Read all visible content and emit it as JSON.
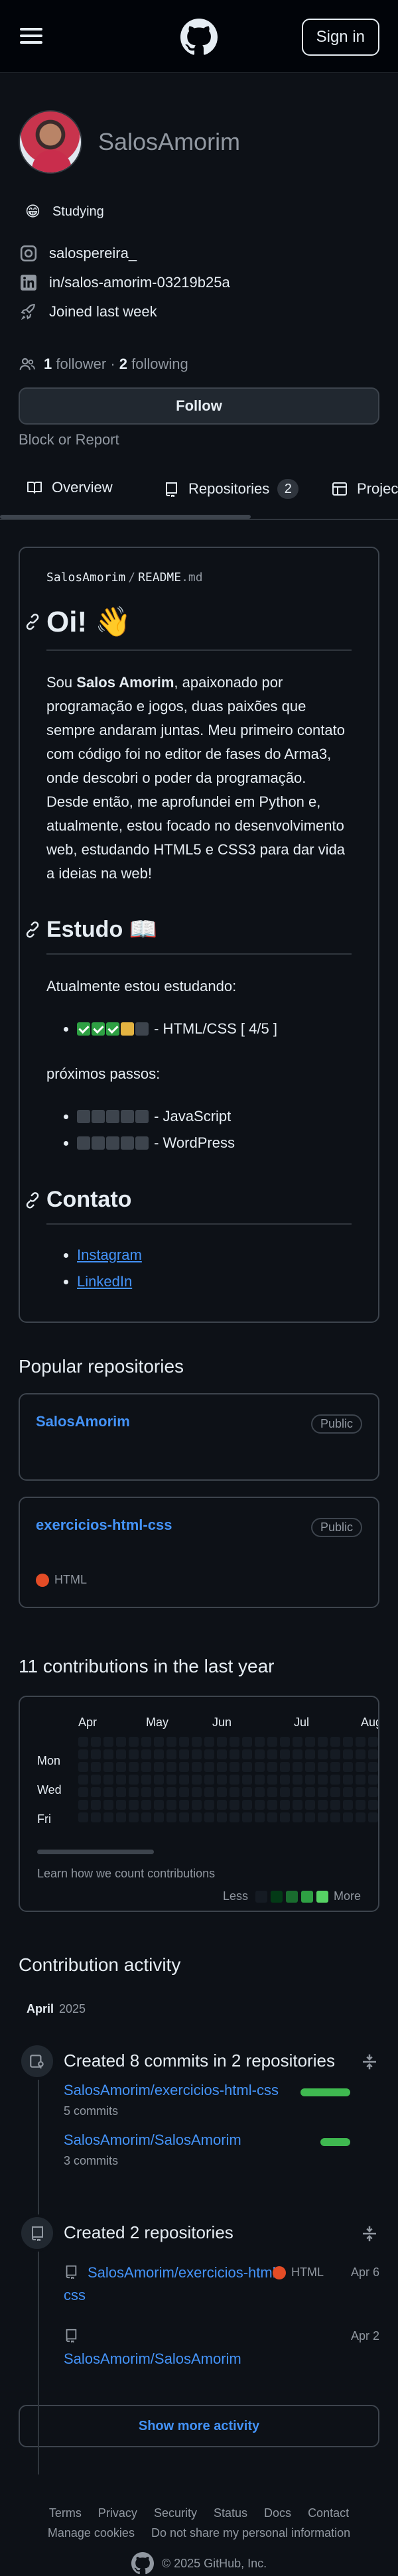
{
  "header": {
    "signin_label": "Sign in"
  },
  "profile": {
    "username": "SalosAmorim",
    "status_emoji": "😁",
    "status_text": "Studying",
    "social_handle": "salospereira_",
    "linkedin": "in/salos-amorim-03219b25a",
    "joined": "Joined last week",
    "followers_count": "1",
    "followers_label": "follower",
    "separator": "·",
    "following_count": "2",
    "following_label": "following",
    "follow_label": "Follow",
    "block_report": "Block or Report"
  },
  "tabs": [
    {
      "label": "Overview",
      "icon": "book-icon"
    },
    {
      "label": "Repositories",
      "icon": "repo-icon",
      "count": "2"
    },
    {
      "label": "Projects",
      "icon": "table-icon"
    }
  ],
  "readme": {
    "path_user": "SalosAmorim",
    "path_sep": "/",
    "path_file": "README",
    "path_ext": ".md",
    "h1": "Oi! 👋",
    "intro_pre": "Sou ",
    "intro_name": "Salos Amorim",
    "intro_post": ", apaixonado por programação e jogos, duas paixões que sempre andaram juntas. Meu primeiro contato com código foi no editor de fases do Arma3, onde descobri o poder da programação. Desde então, me aprofundei em Python e, atualmente, estou focado no desenvolvimento web, estudando HTML5 e CSS3 para dar vida a ideias na web!",
    "h_estudo": "Estudo 📖",
    "estudo_lead": "Atualmente estou estudando:",
    "current_item": " - HTML/CSS [ 4/5 ]",
    "next_lead": "próximos passos:",
    "next_items": [
      " - JavaScript",
      " - WordPress"
    ],
    "h_contato": "Contato",
    "links": [
      "Instagram",
      "LinkedIn"
    ]
  },
  "popular": {
    "title": "Popular repositories",
    "repos": [
      {
        "name": "SalosAmorim",
        "visibility": "Public"
      },
      {
        "name": "exercicios-html-css",
        "visibility": "Public",
        "language": "HTML"
      }
    ]
  },
  "contributions": {
    "title": "11 contributions in the last year",
    "months": [
      "Apr",
      "May",
      "Jun",
      "Jul",
      "Aug"
    ],
    "days": [
      "Mon",
      "Wed",
      "Fri"
    ],
    "learn": "Learn how we count contributions",
    "less": "Less",
    "more": "More",
    "scale_colors": [
      "#151b23",
      "#033a16",
      "#196c2e",
      "#2ea043",
      "#56d364"
    ]
  },
  "activity": {
    "title": "Contribution activity",
    "month": "April",
    "year": "2025",
    "commits_title": "Created 8 commits in 2 repositories",
    "commit_repos": [
      {
        "name": "SalosAmorim/exercicios-html-css",
        "count": "5 commits",
        "share": 0.625
      },
      {
        "name": "SalosAmorim/SalosAmorim",
        "count": "3 commits",
        "share": 0.375
      }
    ],
    "created_title": "Created 2 repositories",
    "created_repos": [
      {
        "name": "SalosAmorim/exercicios-html-css",
        "language": "HTML",
        "date": "Apr 6"
      },
      {
        "name": "SalosAmorim/SalosAmorim",
        "date": "Apr 2"
      }
    ],
    "show_more": "Show more activity"
  },
  "footer": {
    "links_row1": [
      "Terms",
      "Privacy",
      "Security",
      "Status",
      "Docs",
      "Contact"
    ],
    "links_row2": [
      "Manage cookies",
      "Do not share my personal information"
    ],
    "copyright": "© 2025 GitHub, Inc."
  }
}
